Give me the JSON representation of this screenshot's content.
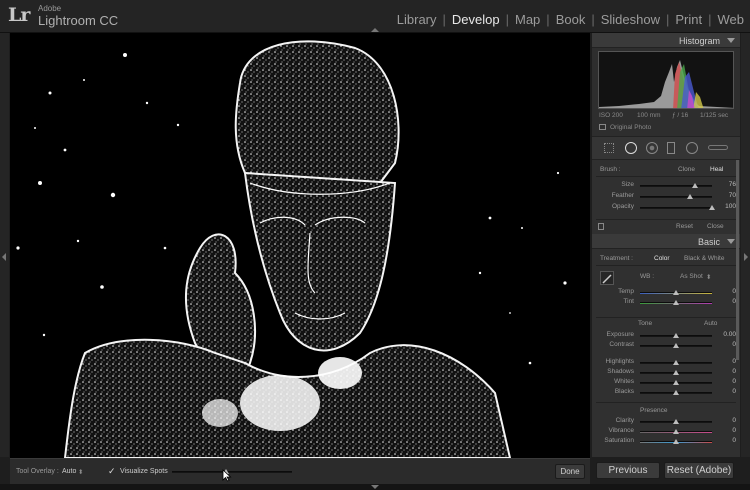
{
  "app": {
    "logo": "Lr",
    "vendor": "Adobe",
    "product": "Lightroom CC"
  },
  "modules": [
    "Library",
    "Develop",
    "Map",
    "Book",
    "Slideshow",
    "Print",
    "Web"
  ],
  "active_module": "Develop",
  "histogram": {
    "title": "Histogram",
    "iso": "ISO 200",
    "focal": "100 mm",
    "aperture": "ƒ / 16",
    "shutter": "1/125 sec",
    "original_photo_label": "Original Photo"
  },
  "spot_removal": {
    "brush_label": "Brush :",
    "clone_label": "Clone",
    "heal_label": "Heal",
    "sliders": [
      {
        "label": "Size",
        "value": "76",
        "fraction": 0.76
      },
      {
        "label": "Feather",
        "value": "70",
        "fraction": 0.7
      },
      {
        "label": "Opacity",
        "value": "100",
        "fraction": 1.0
      }
    ],
    "reset_label": "Reset",
    "close_label": "Close"
  },
  "basic": {
    "title": "Basic",
    "treatment_label": "Treatment :",
    "color_label": "Color",
    "bw_label": "Black & White",
    "wb_label": "WB :",
    "wb_value": "As Shot",
    "temp_label": "Temp",
    "temp_value": "0",
    "tint_label": "Tint",
    "tint_value": "0",
    "tone_label": "Tone",
    "auto_label": "Auto",
    "exposure_label": "Exposure",
    "exposure_value": "0.00",
    "contrast_label": "Contrast",
    "contrast_value": "0",
    "highlights_label": "Highlights",
    "highlights_value": "0",
    "shadows_label": "Shadows",
    "shadows_value": "0",
    "whites_label": "Whites",
    "whites_value": "0",
    "blacks_label": "Blacks",
    "blacks_value": "0",
    "presence_label": "Presence",
    "clarity_label": "Clarity",
    "clarity_value": "0",
    "vibrance_label": "Vibrance",
    "vibrance_value": "0",
    "saturation_label": "Saturation",
    "saturation_value": "0"
  },
  "toolbar": {
    "tool_overlay_label": "Tool Overlay :",
    "tool_overlay_value": "Auto",
    "visualize_spots_label": "Visualize Spots",
    "visualize_spots_checked": true,
    "visualize_threshold": 0.45,
    "done_label": "Done"
  },
  "buttons": {
    "previous_label": "Previous",
    "reset_label": "Reset (Adobe)"
  },
  "colors": {
    "background": "#1e1e1e",
    "panel": "#2e2e2e",
    "active_text": "#e8e8e8"
  }
}
